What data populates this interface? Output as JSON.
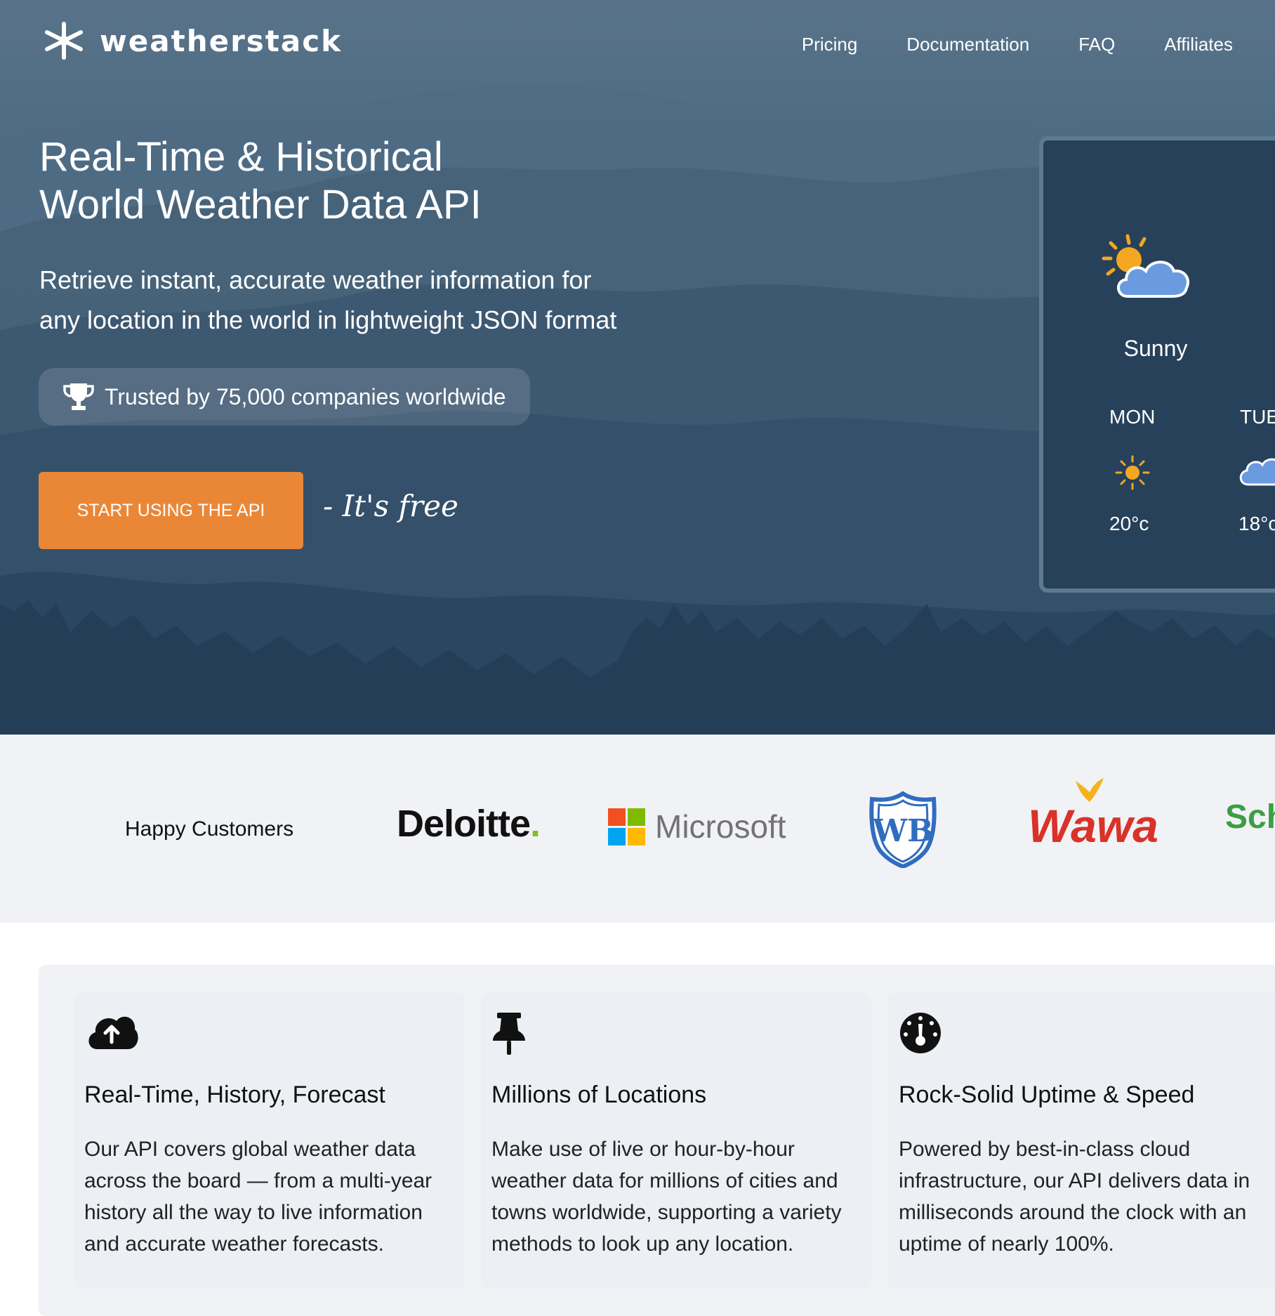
{
  "brand": {
    "name": "weatherstack"
  },
  "nav": {
    "items": [
      "Pricing",
      "Documentation",
      "FAQ",
      "Affiliates"
    ]
  },
  "hero": {
    "headline_line1": "Real-Time & Historical",
    "headline_line2": "World Weather Data API",
    "sub_line1": "Retrieve instant, accurate weather information for",
    "sub_line2": "any location in the world in lightweight JSON format",
    "trusted": "Trusted by 75,000 companies worldwide",
    "cta": "START USING THE API",
    "free_note": "- It's free"
  },
  "widget": {
    "condition": "Sunny",
    "days": [
      {
        "day": "MON",
        "temp": "20°c",
        "icon": "sun-icon"
      },
      {
        "day": "TUE",
        "temp": "18°c",
        "icon": "cloud-icon"
      }
    ]
  },
  "customers": {
    "label": "Happy Customers",
    "logos": [
      "Deloitte",
      "Microsoft",
      "WB",
      "Wawa",
      "Sch"
    ]
  },
  "features": [
    {
      "icon": "cloud-upload-icon",
      "title": "Real-Time, History, Forecast",
      "text": "Our API covers global weather data across the board — from a multi-year history all the way to live information and accurate weather forecasts."
    },
    {
      "icon": "pin-icon",
      "title": "Millions of Locations",
      "text": "Make use of live or hour-by-hour weather data for millions of cities and towns worldwide, supporting a variety methods to look up any location."
    },
    {
      "icon": "speedometer-icon",
      "title": "Rock-Solid Uptime & Speed",
      "text": "Powered by best-in-class cloud infrastructure, our API delivers data in milliseconds around the clock with an uptime of nearly 100%."
    }
  ],
  "colors": {
    "accent": "#ea8737",
    "hero_dark": "#27415a",
    "sun": "#f5a623",
    "cloud": "#6a9be0"
  }
}
